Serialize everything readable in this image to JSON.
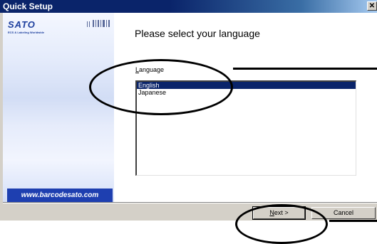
{
  "window": {
    "title": "Quick Setup",
    "close_glyph": "✕"
  },
  "sidebar": {
    "brand": "SATO",
    "tagline": "ECS & Labeling Worldwide",
    "website": "www.barcodesato.com"
  },
  "main": {
    "heading": "Please select your language",
    "language_label_first": "L",
    "language_label_rest": "anguage",
    "options": [
      {
        "label": "English",
        "selected": true
      },
      {
        "label": "Japanese",
        "selected": false
      }
    ]
  },
  "buttons": {
    "next_first": "N",
    "next_rest": "ext >",
    "cancel": "Cancel"
  },
  "colors": {
    "selection": "#0a246a",
    "brand_blue": "#1e3fb0"
  },
  "icons": [
    "close-icon",
    "barcode-icon"
  ]
}
